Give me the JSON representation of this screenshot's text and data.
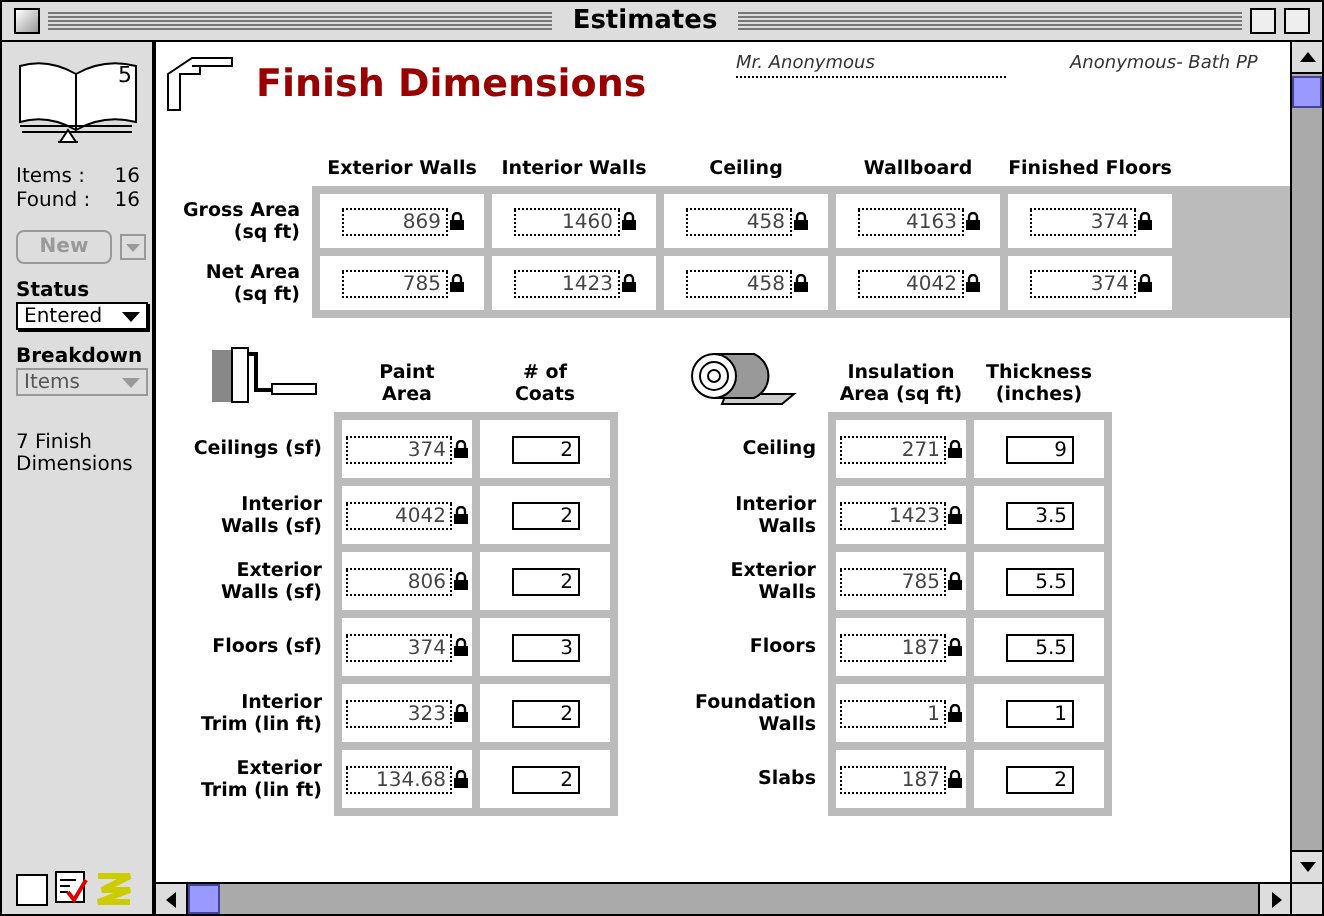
{
  "window": {
    "title": "Estimates"
  },
  "sidebar": {
    "record_number": "5",
    "stats": [
      {
        "label": "Items :",
        "value": "16"
      },
      {
        "label": "Found :",
        "value": "16"
      }
    ],
    "new_button": {
      "label": "New",
      "disabled": true
    },
    "status": {
      "label": "Status",
      "value": "Entered",
      "disabled": false
    },
    "breakdown": {
      "label": "Breakdown",
      "value": "Items",
      "disabled": true
    },
    "section": "7 Finish Dimensions"
  },
  "header": {
    "title": "Finish Dimensions",
    "owner": "Mr. Anonymous",
    "project": "Anonymous- Bath PP"
  },
  "area_table": {
    "columns": [
      "Exterior Walls",
      "Interior Walls",
      "Ceiling",
      "Wallboard",
      "Finished Floors"
    ],
    "rows": [
      {
        "label": "Gross Area\n(sq ft)",
        "cells": [
          {
            "value": "869",
            "locked": true
          },
          {
            "value": "1460",
            "locked": true
          },
          {
            "value": "458",
            "locked": true
          },
          {
            "value": "4163",
            "locked": true
          },
          {
            "value": "374",
            "locked": true
          }
        ]
      },
      {
        "label": "Net Area\n(sq ft)",
        "cells": [
          {
            "value": "785",
            "locked": true
          },
          {
            "value": "1423",
            "locked": true
          },
          {
            "value": "458",
            "locked": true
          },
          {
            "value": "4042",
            "locked": true
          },
          {
            "value": "374",
            "locked": true
          }
        ]
      }
    ]
  },
  "paint_table": {
    "columns": [
      "Paint\nArea",
      "# of\nCoats"
    ],
    "rows": [
      {
        "label": "Ceilings (sf)",
        "cells": [
          {
            "value": "374",
            "locked": true
          },
          {
            "value": "2",
            "locked": false
          }
        ]
      },
      {
        "label": "Interior\nWalls (sf)",
        "cells": [
          {
            "value": "4042",
            "locked": true
          },
          {
            "value": "2",
            "locked": false
          }
        ]
      },
      {
        "label": "Exterior\nWalls (sf)",
        "cells": [
          {
            "value": "806",
            "locked": true
          },
          {
            "value": "2",
            "locked": false
          }
        ]
      },
      {
        "label": "Floors (sf)",
        "cells": [
          {
            "value": "374",
            "locked": true
          },
          {
            "value": "3",
            "locked": false
          }
        ]
      },
      {
        "label": "Interior\nTrim (lin ft)",
        "cells": [
          {
            "value": "323",
            "locked": true
          },
          {
            "value": "2",
            "locked": false
          }
        ]
      },
      {
        "label": "Exterior\nTrim (lin ft)",
        "cells": [
          {
            "value": "134.68",
            "locked": true
          },
          {
            "value": "2",
            "locked": false
          }
        ]
      }
    ]
  },
  "insulation_table": {
    "columns": [
      "Insulation\nArea (sq ft)",
      "Thickness\n(inches)"
    ],
    "rows": [
      {
        "label": "Ceiling",
        "cells": [
          {
            "value": "271",
            "locked": true
          },
          {
            "value": "9",
            "locked": false
          }
        ]
      },
      {
        "label": "Interior\nWalls",
        "cells": [
          {
            "value": "1423",
            "locked": true
          },
          {
            "value": "3.5",
            "locked": false
          }
        ]
      },
      {
        "label": "Exterior\nWalls",
        "cells": [
          {
            "value": "785",
            "locked": true
          },
          {
            "value": "5.5",
            "locked": false
          }
        ]
      },
      {
        "label": "Floors",
        "cells": [
          {
            "value": "187",
            "locked": true
          },
          {
            "value": "5.5",
            "locked": false
          }
        ]
      },
      {
        "label": "Foundation\nWalls",
        "cells": [
          {
            "value": "1",
            "locked": true
          },
          {
            "value": "1",
            "locked": false
          }
        ]
      },
      {
        "label": "Slabs",
        "cells": [
          {
            "value": "187",
            "locked": true
          },
          {
            "value": "2",
            "locked": false
          }
        ]
      }
    ]
  }
}
